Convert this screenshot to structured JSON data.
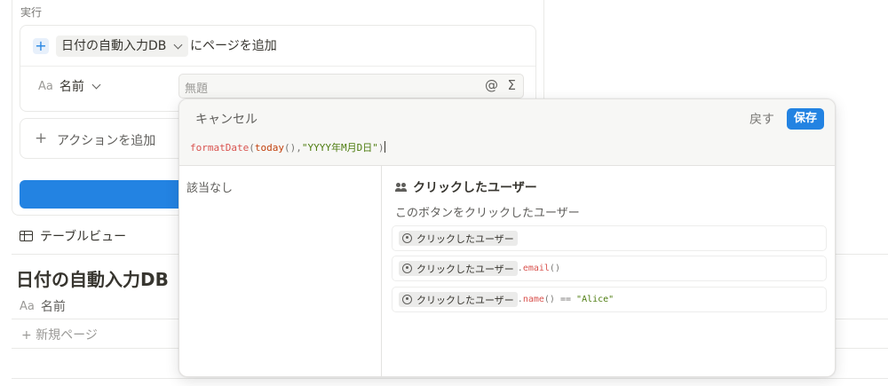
{
  "section": {
    "label": "実行"
  },
  "action": {
    "db_name": "日付の自動入力DB",
    "add_page_text": "にページを追加",
    "property_label": "名前",
    "property_type": "Aa",
    "title_placeholder": "無題",
    "at_symbol": "@",
    "sigma_symbol": "Σ"
  },
  "add_action": {
    "plus": "+",
    "label": "アクションを追加"
  },
  "view": {
    "tab_label": "テーブルビュー"
  },
  "database": {
    "title": "日付の自動入力DB",
    "column_type": "Aa",
    "column_name": "名前",
    "new_page": "+ 新規ページ"
  },
  "popup": {
    "cancel": "キャンセル",
    "back": "戻す",
    "save": "保存",
    "formula": {
      "fn1": "formatDate",
      "p1": "(",
      "fn2": "today",
      "p2": "(),",
      "str": "\"YYYY年M月D日\"",
      "p3": ")"
    },
    "no_match": "該当なし",
    "detail": {
      "title": "クリックしたユーザー",
      "description": "このボタンをクリックしたユーザー",
      "examples": [
        {
          "chip": "クリックしたユーザー",
          "dot": "",
          "fn": "",
          "rest": "",
          "op": "",
          "str": ""
        },
        {
          "chip": "クリックしたユーザー",
          "dot": ".",
          "fn": "email",
          "rest": "()",
          "op": "",
          "str": ""
        },
        {
          "chip": "クリックしたユーザー",
          "dot": ".",
          "fn": "name",
          "rest": "()",
          "op": " == ",
          "str": "\"Alice\""
        }
      ]
    }
  },
  "colors": {
    "accent": "#2383e2",
    "text": "#37352f",
    "muted": "#787774",
    "code_fn": "#d9534f",
    "code_str": "#4d7c0f"
  }
}
